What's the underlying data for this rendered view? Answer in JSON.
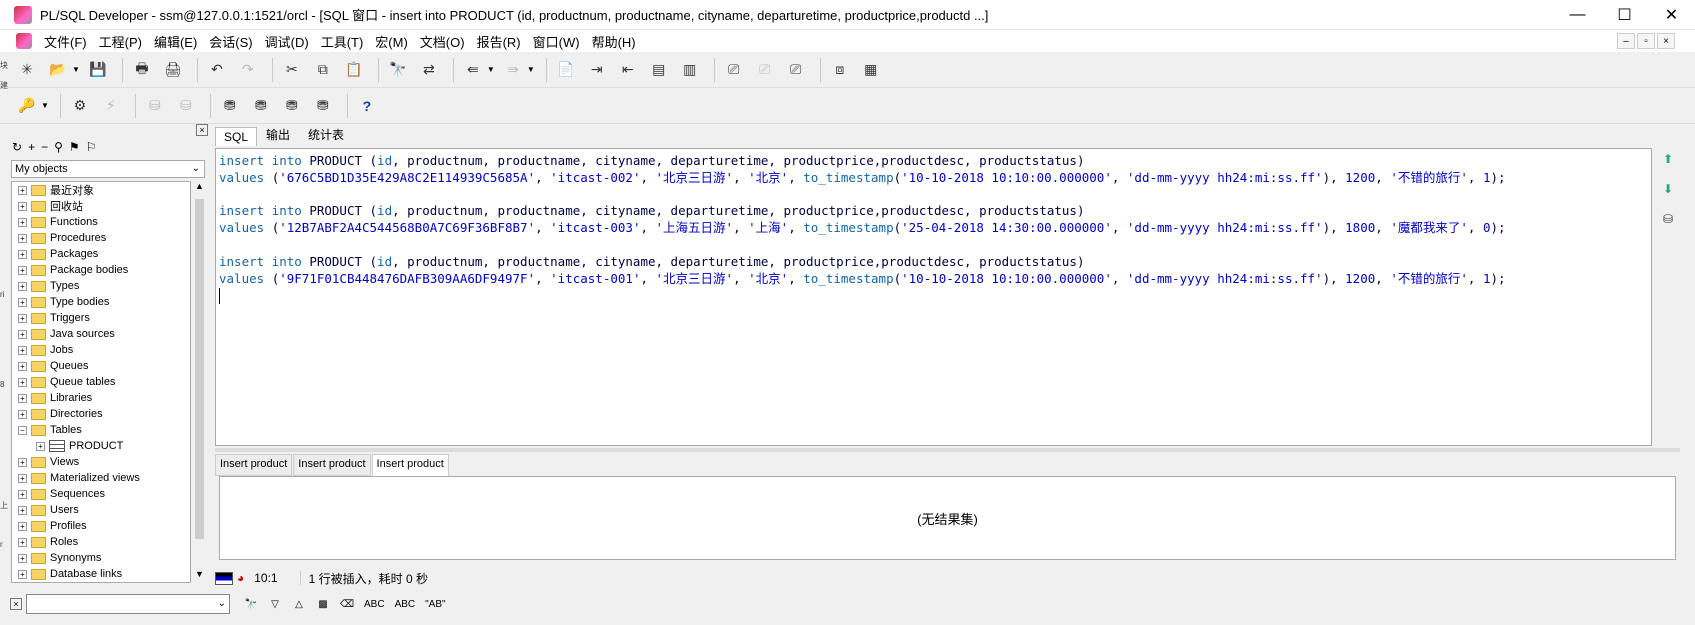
{
  "window": {
    "title": "PL/SQL Developer - ssm@127.0.0.1:1521/orcl - [SQL 窗口 - insert into PRODUCT (id, productnum, productname, cityname, departuretime, productprice,productd ...]",
    "minimize": "—",
    "maximize": "☐",
    "close": "✕"
  },
  "menu": [
    "文件(F)",
    "工程(P)",
    "编辑(E)",
    "会话(S)",
    "调试(D)",
    "工具(T)",
    "宏(M)",
    "文档(O)",
    "报告(R)",
    "窗口(W)",
    "帮助(H)"
  ],
  "mdi_controls": [
    "–",
    "▫",
    "×"
  ],
  "left_panel": {
    "close": "×",
    "selector": "My objects",
    "tree": [
      {
        "label": "最近对象",
        "exp": "+"
      },
      {
        "label": "回收站",
        "exp": "+"
      },
      {
        "label": "Functions",
        "exp": "+"
      },
      {
        "label": "Procedures",
        "exp": "+"
      },
      {
        "label": "Packages",
        "exp": "+"
      },
      {
        "label": "Package bodies",
        "exp": "+"
      },
      {
        "label": "Types",
        "exp": "+"
      },
      {
        "label": "Type bodies",
        "exp": "+"
      },
      {
        "label": "Triggers",
        "exp": "+"
      },
      {
        "label": "Java sources",
        "exp": "+"
      },
      {
        "label": "Jobs",
        "exp": "+"
      },
      {
        "label": "Queues",
        "exp": "+"
      },
      {
        "label": "Queue tables",
        "exp": "+"
      },
      {
        "label": "Libraries",
        "exp": "+"
      },
      {
        "label": "Directories",
        "exp": "+"
      },
      {
        "label": "Tables",
        "exp": "−"
      },
      {
        "label": "PRODUCT",
        "exp": "+",
        "child": true
      },
      {
        "label": "Views",
        "exp": "+"
      },
      {
        "label": "Materialized views",
        "exp": "+"
      },
      {
        "label": "Sequences",
        "exp": "+"
      },
      {
        "label": "Users",
        "exp": "+"
      },
      {
        "label": "Profiles",
        "exp": "+"
      },
      {
        "label": "Roles",
        "exp": "+"
      },
      {
        "label": "Synonyms",
        "exp": "+"
      },
      {
        "label": "Database links",
        "exp": "+"
      }
    ]
  },
  "editor_tabs": [
    "SQL",
    "输出",
    "统计表"
  ],
  "code_lines": [
    [
      [
        "kw",
        "insert into "
      ],
      [
        "id",
        "PRODUCT ("
      ],
      [
        "kw",
        "id"
      ],
      [
        "id",
        ", productnum, productname, cityname, departuretime, productprice,productdesc, productstatus)"
      ]
    ],
    [
      [
        "kw",
        "values "
      ],
      [
        "id",
        "("
      ],
      [
        "str",
        "'676C5BD1D35E429A8C2E114939C5685A'"
      ],
      [
        "id",
        ", "
      ],
      [
        "str",
        "'itcast-002'"
      ],
      [
        "id",
        ", "
      ],
      [
        "str",
        "'北京三日游'"
      ],
      [
        "id",
        ", "
      ],
      [
        "str",
        "'北京'"
      ],
      [
        "id",
        ", "
      ],
      [
        "kw",
        "to_timestamp"
      ],
      [
        "id",
        "("
      ],
      [
        "str",
        "'10-10-2018 10:10:00.000000'"
      ],
      [
        "id",
        ", "
      ],
      [
        "str",
        "'dd-mm-yyyy hh24:mi:ss.ff'"
      ],
      [
        "id",
        "), "
      ],
      [
        "str",
        "1200"
      ],
      [
        "id",
        ", "
      ],
      [
        "str",
        "'不错的旅行'"
      ],
      [
        "id",
        ", "
      ],
      [
        "str",
        "1"
      ],
      [
        "id",
        ");"
      ]
    ],
    [],
    [
      [
        "kw",
        "insert into "
      ],
      [
        "id",
        "PRODUCT ("
      ],
      [
        "kw",
        "id"
      ],
      [
        "id",
        ", productnum, productname, cityname, departuretime, productprice,productdesc, productstatus)"
      ]
    ],
    [
      [
        "kw",
        "values "
      ],
      [
        "id",
        "("
      ],
      [
        "str",
        "'12B7ABF2A4C544568B0A7C69F36BF8B7'"
      ],
      [
        "id",
        ", "
      ],
      [
        "str",
        "'itcast-003'"
      ],
      [
        "id",
        ", "
      ],
      [
        "str",
        "'上海五日游'"
      ],
      [
        "id",
        ", "
      ],
      [
        "str",
        "'上海'"
      ],
      [
        "id",
        ", "
      ],
      [
        "kw",
        "to_timestamp"
      ],
      [
        "id",
        "("
      ],
      [
        "str",
        "'25-04-2018 14:30:00.000000'"
      ],
      [
        "id",
        ", "
      ],
      [
        "str",
        "'dd-mm-yyyy hh24:mi:ss.ff'"
      ],
      [
        "id",
        "), "
      ],
      [
        "str",
        "1800"
      ],
      [
        "id",
        ", "
      ],
      [
        "str",
        "'魔都我来了'"
      ],
      [
        "id",
        ", "
      ],
      [
        "str",
        "0"
      ],
      [
        "id",
        ");"
      ]
    ],
    [],
    [
      [
        "kw",
        "insert into "
      ],
      [
        "id",
        "PRODUCT ("
      ],
      [
        "kw",
        "id"
      ],
      [
        "id",
        ", productnum, productname, cityname, departuretime, productprice,productdesc, productstatus)"
      ]
    ],
    [
      [
        "kw",
        "values "
      ],
      [
        "id",
        "("
      ],
      [
        "str",
        "'9F71F01CB448476DAFB309AA6DF9497F'"
      ],
      [
        "id",
        ", "
      ],
      [
        "str",
        "'itcast-001'"
      ],
      [
        "id",
        ", "
      ],
      [
        "str",
        "'北京三日游'"
      ],
      [
        "id",
        ", "
      ],
      [
        "str",
        "'北京'"
      ],
      [
        "id",
        ", "
      ],
      [
        "kw",
        "to_timestamp"
      ],
      [
        "id",
        "("
      ],
      [
        "str",
        "'10-10-2018 10:10:00.000000'"
      ],
      [
        "id",
        ", "
      ],
      [
        "str",
        "'dd-mm-yyyy hh24:mi:ss.ff'"
      ],
      [
        "id",
        "), "
      ],
      [
        "str",
        "1200"
      ],
      [
        "id",
        ", "
      ],
      [
        "str",
        "'不错的旅行'"
      ],
      [
        "id",
        ", "
      ],
      [
        "str",
        "1"
      ],
      [
        "id",
        ");"
      ]
    ],
    []
  ],
  "result_tabs": [
    "Insert product",
    "Insert product",
    "Insert product"
  ],
  "results_message": "(无结果集)",
  "status": {
    "position": "10:1",
    "message": "1 行被插入，耗时 0 秒"
  },
  "findbar": {
    "close": "×",
    "abc1": "ABC",
    "abc2": "ABC",
    "ab": "\"AB\""
  },
  "left_edge_text": [
    "块",
    "ri",
    "8",
    "上",
    "r",
    "建"
  ],
  "colors": {
    "keyword": "#1166aa",
    "string": "#0000cc"
  }
}
